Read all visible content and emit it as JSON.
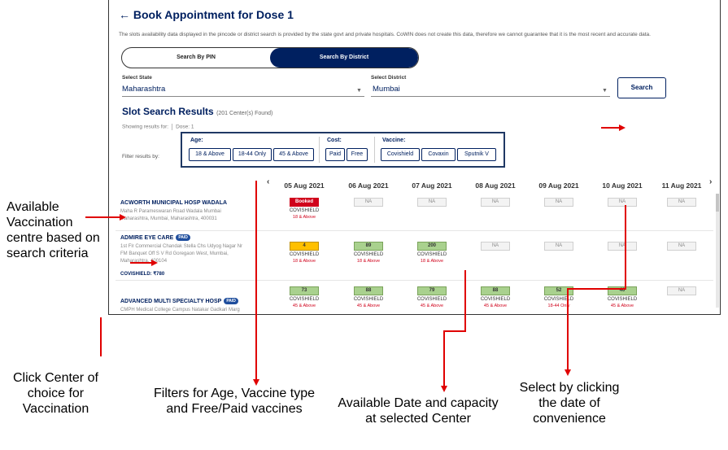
{
  "header": {
    "title": "Book Appointment for Dose 1",
    "notice": "The slots availability data displayed in the pincode or district search is provided by the state govt and private hospitals. CoWIN does not create this data, therefore we cannot guarantee that it is the most recent and accurate data."
  },
  "toggle": {
    "pin_label": "Search By PIN",
    "district_label": "Search By District"
  },
  "state": {
    "label": "Select State",
    "value": "Maharashtra"
  },
  "district": {
    "label": "Select District",
    "value": "Mumbai"
  },
  "search_label": "Search",
  "results": {
    "heading": "Slot Search Results",
    "count": "(201 Center(s) Found)",
    "showing_label": "Showing results for:",
    "showing_value": "Dose: 1",
    "filter_label": "Filter results by:"
  },
  "filters": {
    "age_label": "Age:",
    "age_options": [
      "18 & Above",
      "18-44 Only",
      "45 & Above"
    ],
    "cost_label": "Cost:",
    "cost_options": [
      "Paid",
      "Free"
    ],
    "vaccine_label": "Vaccine:",
    "vaccine_options": [
      "Covishield",
      "Covaxin",
      "Sputnik V"
    ]
  },
  "dates": [
    "05 Aug 2021",
    "06 Aug 2021",
    "07 Aug 2021",
    "08 Aug 2021",
    "09 Aug 2021",
    "10 Aug 2021",
    "11 Aug 2021"
  ],
  "nav": {
    "prev": "‹",
    "next": "›"
  },
  "paid_tag": "PAID",
  "centers": [
    {
      "name": "ACWORTH MUNICIPAL HOSP WADALA",
      "address": "Maha R Parameswaran Road Wadala Mumbai\nMaharashtra, Mumbai, Maharashtra, 400031",
      "paid": false,
      "pricing": "",
      "slots": [
        {
          "badge": "Booked",
          "vaccine": "COVISHIELD",
          "age": "18 & Above",
          "kind": "booked"
        },
        {
          "badge": "NA",
          "vaccine": "",
          "age": "",
          "kind": "na"
        },
        {
          "badge": "NA",
          "vaccine": "",
          "age": "",
          "kind": "na"
        },
        {
          "badge": "NA",
          "vaccine": "",
          "age": "",
          "kind": "na"
        },
        {
          "badge": "NA",
          "vaccine": "",
          "age": "",
          "kind": "na"
        },
        {
          "badge": "NA",
          "vaccine": "",
          "age": "",
          "kind": "na"
        },
        {
          "badge": "NA",
          "vaccine": "",
          "age": "",
          "kind": "na"
        }
      ]
    },
    {
      "name": "ADMIRE EYE CARE",
      "address": "1st Flr Commercial Chandak Stella Chs Udyog Nagar Nr\nFM Banquet Off S V Rd Goregaon West, Mumbai,\nMaharashtra, 400104",
      "paid": true,
      "pricing": "COVISHIELD: ₹780",
      "slots": [
        {
          "badge": "4",
          "vaccine": "COVISHIELD",
          "age": "18 & Above",
          "kind": "yellow"
        },
        {
          "badge": "89",
          "vaccine": "COVISHIELD",
          "age": "18 & Above",
          "kind": "green"
        },
        {
          "badge": "200",
          "vaccine": "COVISHIELD",
          "age": "18 & Above",
          "kind": "green"
        },
        {
          "badge": "NA",
          "vaccine": "",
          "age": "",
          "kind": "na"
        },
        {
          "badge": "NA",
          "vaccine": "",
          "age": "",
          "kind": "na"
        },
        {
          "badge": "NA",
          "vaccine": "",
          "age": "",
          "kind": "na"
        },
        {
          "badge": "NA",
          "vaccine": "",
          "age": "",
          "kind": "na"
        }
      ]
    },
    {
      "name": "ADVANCED MULTI SPECIALTY HOSP",
      "address": "CMPH Medical College Campus Natakar Gadkari Marg",
      "paid": true,
      "pricing": "",
      "slots": [
        {
          "badge": "73",
          "vaccine": "COVISHIELD",
          "age": "45 & Above",
          "kind": "green"
        },
        {
          "badge": "88",
          "vaccine": "COVISHIELD",
          "age": "45 & Above",
          "kind": "green"
        },
        {
          "badge": "79",
          "vaccine": "COVISHIELD",
          "age": "45 & Above",
          "kind": "green"
        },
        {
          "badge": "88",
          "vaccine": "COVISHIELD",
          "age": "45 & Above",
          "kind": "green"
        },
        {
          "badge": "52",
          "vaccine": "COVISHIELD",
          "age": "18-44 Only",
          "kind": "green"
        },
        {
          "badge": "40",
          "vaccine": "COVISHIELD",
          "age": "45 & Above",
          "kind": "green"
        },
        {
          "badge": "NA",
          "vaccine": "",
          "age": "",
          "kind": "na"
        }
      ]
    }
  ],
  "annotations": {
    "centre": "Available\nVaccination\ncentre based on\nsearch criteria",
    "click": "Click Center of\nchoice for\nVaccination",
    "filters": "Filters for Age, Vaccine type\nand Free/Paid vaccines",
    "dates": "Available Date and capacity\nat selected Center",
    "select": "Select by clicking\nthe date of\nconvenience"
  }
}
